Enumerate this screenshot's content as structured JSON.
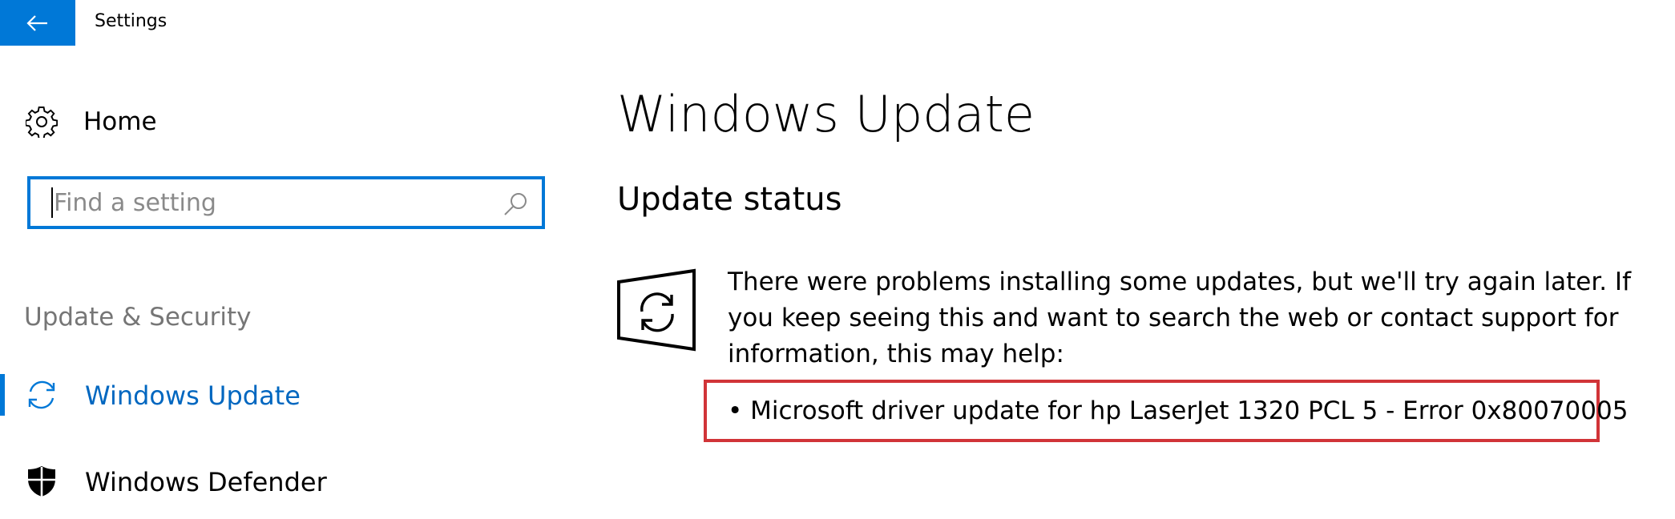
{
  "window": {
    "title": "Settings"
  },
  "sidebar": {
    "home_label": "Home",
    "search": {
      "placeholder": "Find a setting",
      "value": ""
    },
    "section_heading": "Update & Security",
    "items": [
      {
        "label": "Windows Update",
        "icon": "sync-icon",
        "selected": true
      },
      {
        "label": "Windows Defender",
        "icon": "shield-icon",
        "selected": false
      }
    ]
  },
  "main": {
    "title": "Windows Update",
    "status_heading": "Update status",
    "status_message": "There were problems installing some updates, but we'll try again later. If you keep seeing this and want to search the web or contact support for information, this may help:",
    "failed_updates": [
      "• Microsoft driver update for hp LaserJet 1320 PCL 5 - Error 0x80070005"
    ]
  },
  "colors": {
    "accent": "#0078d7",
    "highlight_border": "#d13438",
    "muted_text": "#767676"
  }
}
